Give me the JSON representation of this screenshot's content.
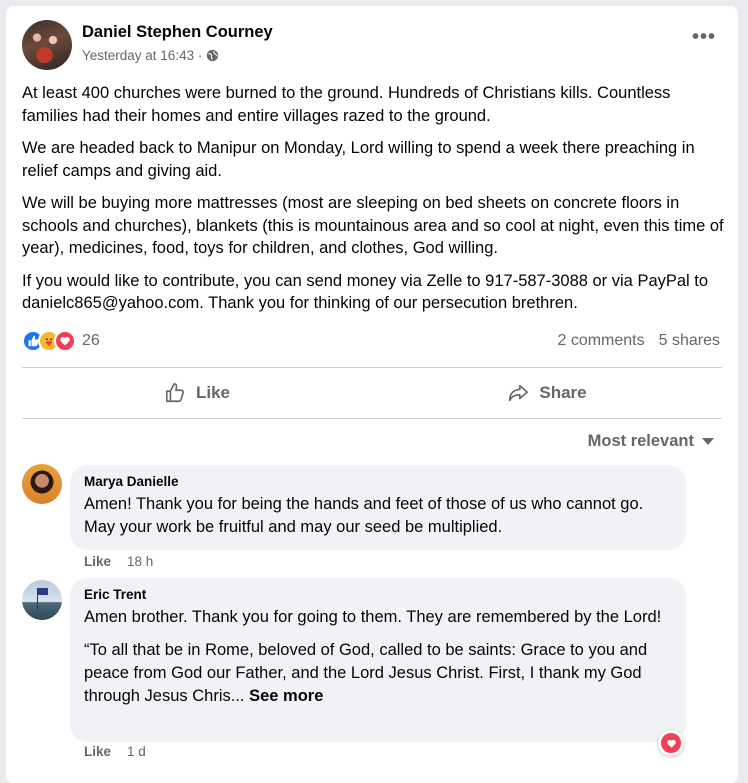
{
  "post": {
    "author": "Daniel Stephen Courney",
    "timestamp": "Yesterday at 16:43 ·",
    "privacy_icon": "globe-icon",
    "more_label": "•••",
    "paragraphs": [
      "At least 400 churches were burned to the ground. Hundreds of Christians kills. Countless families had their homes and entire villages razed to the ground.",
      "We are headed back to Manipur on Monday, Lord willing to spend a week there preaching in relief camps and giving aid.",
      "We will be buying more mattresses (most are sleeping on bed sheets on concrete floors in schools and churches), blankets (this is mountainous area and so cool at night, even this time of year), medicines, food, toys for children, and clothes, God willing.",
      "If you would like to contribute, you can send money via Zelle to 917-587-3088 or via PayPal to danielc865@yahoo.com. Thank you for thinking of our persecution brethren."
    ],
    "reactions": {
      "types": [
        "like",
        "care",
        "love"
      ],
      "count": "26",
      "colors": {
        "like": "#1877f2",
        "care": "#f7b928",
        "love": "#f33e58"
      }
    },
    "comments_count": "2 comments",
    "shares_count": "5 shares"
  },
  "actions": {
    "like_label": "Like",
    "share_label": "Share"
  },
  "sort": {
    "label": "Most relevant"
  },
  "comments": [
    {
      "name": "Marya Danielle",
      "text": "Amen! Thank you for being the hands and feet of those of us who cannot go. May your work be fruitful and may our seed be multiplied.",
      "like_label": "Like",
      "time": "18 h"
    },
    {
      "name": "Eric Trent",
      "text": "Amen brother. Thank you for going to them. They are remembered by the Lord!",
      "text2": "“To all that be in Rome, beloved of God, called to be saints: Grace to you and peace from God our Father, and the Lord Jesus Christ. First, I thank my God through Jesus Chris...",
      "see_more": "See more",
      "like_label": "Like",
      "time": "1 d",
      "reaction": "love"
    }
  ]
}
